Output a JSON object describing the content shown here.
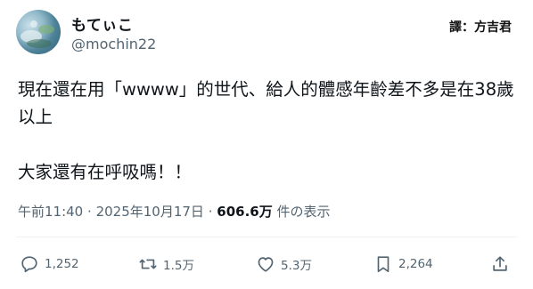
{
  "author": {
    "display_name": "もてぃこ",
    "handle": "@mochin22"
  },
  "translator_tag": "譯：方吉君",
  "tweet": {
    "lines": [
      "現在還在用「wwww」的世代、給人的體感年齡差不多是在38歲",
      "以上",
      "大家還有在呼吸嗎！！"
    ]
  },
  "meta": {
    "time": "午前11:40",
    "separator": "·",
    "date": "2025年10月17日",
    "views": "606.6万",
    "views_suffix": "件の表示"
  },
  "actions": {
    "reply_count": "1,252",
    "repost_count": "1.5万",
    "like_count": "5.3万",
    "bookmark_count": "2,264"
  },
  "icons": {
    "reply": "reply-icon",
    "repost": "repost-icon",
    "like": "heart-icon",
    "bookmark": "bookmark-icon",
    "share": "share-icon"
  },
  "colors": {
    "text": "#0f1419",
    "secondary": "#536471",
    "divider": "#eff3f4"
  }
}
